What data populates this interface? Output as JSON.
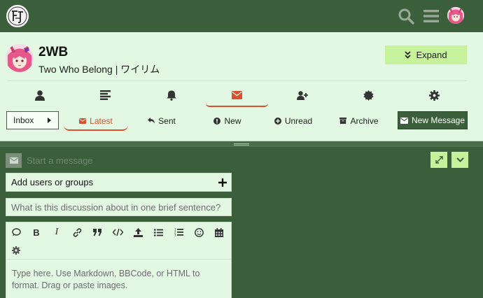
{
  "header": {
    "logo_icon": "site-logo-icon",
    "icons": [
      "search-icon",
      "hamburger-menu-icon",
      "user-avatar-icon"
    ]
  },
  "profile": {
    "username": "2WB",
    "full_name": "Two Who Belong | ワイリム",
    "expand_label": "Expand"
  },
  "nav_icons": [
    {
      "name": "profile-user-icon",
      "active": false
    },
    {
      "name": "activity-list-icon",
      "active": false
    },
    {
      "name": "notifications-bell-icon",
      "active": false
    },
    {
      "name": "messages-envelope-icon",
      "active": true
    },
    {
      "name": "invite-user-icon",
      "active": false
    },
    {
      "name": "badges-icon",
      "active": false
    },
    {
      "name": "preferences-gear-icon",
      "active": false
    }
  ],
  "messages": {
    "inbox_label": "Inbox",
    "tabs": [
      {
        "label": "Latest",
        "icon": "envelope-icon",
        "active": true
      },
      {
        "label": "Sent",
        "icon": "reply-arrow-icon",
        "active": false
      },
      {
        "label": "New",
        "icon": "exclamation-circle-icon",
        "active": false
      },
      {
        "label": "Unread",
        "icon": "plus-circle-icon",
        "active": false
      },
      {
        "label": "Archive",
        "icon": "archive-box-icon",
        "active": false
      }
    ],
    "new_message_label": "New Message"
  },
  "composer": {
    "title": "Start a message",
    "users_label": "Add users or groups",
    "title_placeholder": "What is this discussion about in one brief sentence?",
    "toolbar_icons": [
      "quote-icon",
      "bold-icon",
      "italic-icon",
      "link-icon",
      "blockquote-icon",
      "code-icon",
      "upload-icon",
      "bullet-list-icon",
      "numbered-list-icon",
      "emoji-icon",
      "calendar-icon",
      "options-gear-icon"
    ],
    "editor_placeholder": "Type here. Use Markdown, BBCode, or HTML to format. Drag or paste images."
  },
  "colors": {
    "header_bg": "#3b5e3b",
    "panel_bg": "#e2f8e2",
    "accent": "#d9512f",
    "button_green": "#c5f29a"
  }
}
